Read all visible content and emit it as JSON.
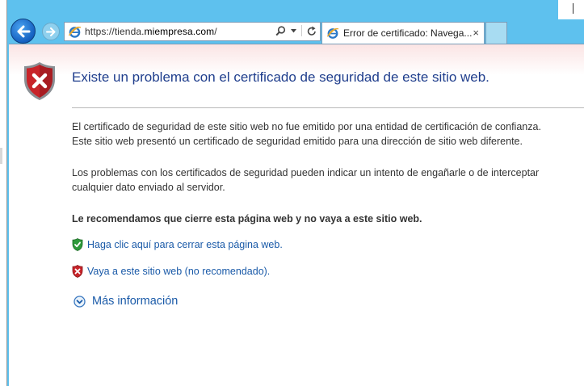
{
  "browser": {
    "address_url_scheme": "https://tienda.",
    "address_url_host": "miempresa.com",
    "address_url_tail": "/",
    "tab_title": "Error de certificado: Navega...",
    "tab_close": "×"
  },
  "page": {
    "title": "Existe un problema con el certificado de seguridad de este sitio web.",
    "para1_line1": "El certificado de seguridad de este sitio web no fue emitido por una entidad de certificación de confianza.",
    "para1_line2": "Este sitio web presentó un certificado de seguridad emitido para una dirección de sitio web diferente.",
    "para2_line1": "Los problemas con los certificados de seguridad pueden indicar un intento de engañarle o de interceptar",
    "para2_line2": "cualquier dato enviado al servidor.",
    "recommendation": "Le recomendamos que cierre esta página web y no vaya a este sitio web.",
    "link_close": "Haga clic aquí para cerrar esta página web.",
    "link_continue": "Vaya a este sitio web (no recomendado).",
    "more_info": "Más información"
  },
  "colors": {
    "frame": "#5ec1ee",
    "title": "#1f3d8c",
    "link": "#1a5aa8",
    "shield_red": "#c8242a",
    "shield_green": "#2e9a3a"
  },
  "icons": {
    "back": "back-arrow-icon",
    "forward": "forward-arrow-icon",
    "site": "ie-page-icon",
    "search": "search-icon",
    "dropdown": "chevron-down-icon",
    "refresh": "refresh-icon",
    "error_shield": "error-shield-icon",
    "safe_shield": "green-shield-check-icon",
    "unsafe_shield": "red-shield-x-icon",
    "expand": "expand-circle-icon"
  }
}
